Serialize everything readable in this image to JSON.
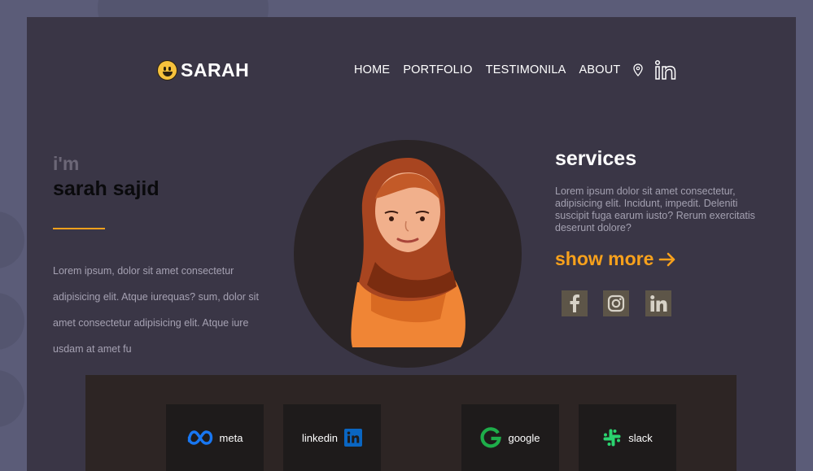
{
  "header": {
    "logo_text": "SARAH",
    "nav": [
      "HOME",
      "PORTFOLIO",
      "TESTIMONILA",
      "ABOUT"
    ],
    "icons": [
      "location-pin-icon",
      "linkedin-icon"
    ]
  },
  "hero": {
    "greeting": "i'm",
    "name": "sarah sajid",
    "intro": "Lorem ipsum, dolor sit amet consectetur adipisicing elit. Atque iurequas? sum, dolor sit amet consectetur adipisicing elit. Atque iure usdam at amet fu"
  },
  "services": {
    "title": "services",
    "text": "Lorem ipsum dolor sit amet consectetur, adipisicing elit. Incidunt, impedit. Deleniti suscipit fuga earum iusto? Rerum exercitatis deserunt dolore?",
    "show_more": "show more",
    "social": [
      "facebook-icon",
      "instagram-icon",
      "linkedin-icon"
    ]
  },
  "brands": {
    "items": [
      {
        "label": "meta",
        "icon": "meta-icon"
      },
      {
        "label": "linkedin",
        "icon": "linkedin-icon"
      },
      {
        "label": "google",
        "icon": "google-icon"
      },
      {
        "label": "slack",
        "icon": "slack-icon"
      }
    ]
  },
  "colors": {
    "accent": "#f7a11c",
    "card_bg": "#3a3646",
    "page_bg": "#5b5c78",
    "brand_strip_bg": "#2d2524"
  }
}
